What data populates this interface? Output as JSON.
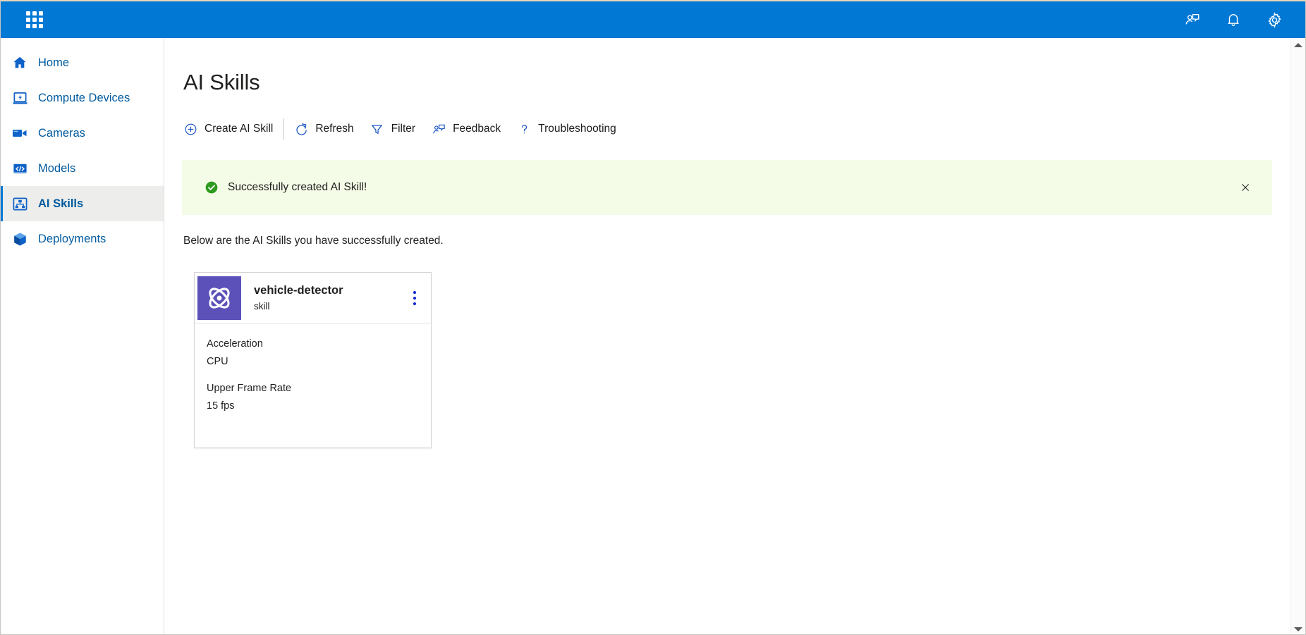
{
  "topbar": {
    "waffle_label": "app-launcher",
    "icons": [
      {
        "name": "feedback-icon",
        "label": "Feedback"
      },
      {
        "name": "notifications-bell-icon",
        "label": "Notifications"
      },
      {
        "name": "settings-gear-icon",
        "label": "Settings"
      }
    ]
  },
  "sidebar": {
    "items": [
      {
        "label": "Home",
        "icon": "home-icon",
        "selected": false
      },
      {
        "label": "Compute Devices",
        "icon": "compute-device-icon",
        "selected": false
      },
      {
        "label": "Cameras",
        "icon": "camera-icon",
        "selected": false
      },
      {
        "label": "Models",
        "icon": "models-code-icon",
        "selected": false
      },
      {
        "label": "AI Skills",
        "icon": "ai-skills-icon",
        "selected": true
      },
      {
        "label": "Deployments",
        "icon": "deployments-cube-icon",
        "selected": false
      }
    ]
  },
  "main": {
    "page_title": "AI Skills",
    "subtitle": "Below are the AI Skills you have successfully created.",
    "toolbar": [
      {
        "label": "Create AI Skill",
        "icon": "plus-circle-icon"
      },
      {
        "label": "Refresh",
        "icon": "refresh-icon"
      },
      {
        "label": "Filter",
        "icon": "filter-funnel-icon"
      },
      {
        "label": "Feedback",
        "icon": "feedback-person-icon"
      },
      {
        "label": "Troubleshooting",
        "icon": "question-mark-icon"
      }
    ],
    "banner": {
      "message": "Successfully created AI Skill!",
      "icon": "success-check-icon",
      "close_icon": "close-icon",
      "background_color": "#f4fbe7",
      "icon_color": "#107C10"
    },
    "cards": [
      {
        "name": "vehicle-detector",
        "subtitle": "skill",
        "thumb_icon": "atom-icon",
        "thumb_color": "#5B51B9",
        "menu_icon": "more-vertical-icon",
        "fields": [
          {
            "label": "Acceleration",
            "value": "CPU"
          },
          {
            "label": "Upper Frame Rate",
            "value": "15 fps"
          }
        ]
      }
    ]
  },
  "scrollbar": {
    "up_icon": "scroll-up-arrow-icon",
    "down_icon": "scroll-down-arrow-icon"
  },
  "colors": {
    "brand_blue": "#0078D4",
    "link_blue": "#005A9E",
    "success_green": "#107C10",
    "card_accent": "#5B51B9"
  }
}
